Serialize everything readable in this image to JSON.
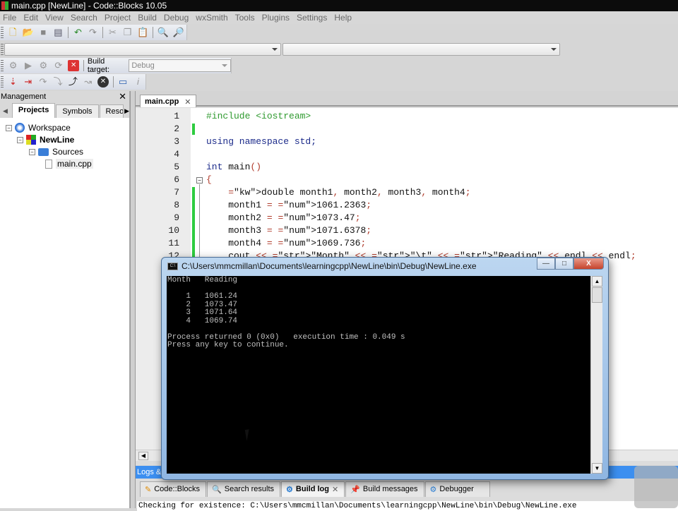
{
  "window": {
    "title": "main.cpp [NewLine] - Code::Blocks 10.05"
  },
  "menu": [
    "File",
    "Edit",
    "View",
    "Search",
    "Project",
    "Build",
    "Debug",
    "wxSmith",
    "Tools",
    "Plugins",
    "Settings",
    "Help"
  ],
  "toolbar": {
    "main_icons": [
      "new-file-icon",
      "open-icon",
      "save-icon",
      "save-all-icon",
      "undo-icon",
      "redo-icon",
      "cut-icon",
      "copy-icon",
      "paste-icon",
      "find-icon",
      "replace-icon"
    ],
    "build_icons": [
      "build-gear-icon",
      "run-icon",
      "build-run-icon",
      "rebuild-icon",
      "abort-icon"
    ],
    "build_target_label": "Build target:",
    "build_target_value": "Debug",
    "debug_icons": [
      "debug-run-icon",
      "run-to-cursor-icon",
      "next-line-icon",
      "step-into-icon",
      "step-out-icon",
      "next-instruction-icon",
      "stop-debug-icon",
      "debug-windows-icon",
      "info-icon"
    ]
  },
  "management": {
    "title": "Management",
    "tabs": [
      "Projects",
      "Symbols",
      "Resou"
    ],
    "active_tab": "Projects",
    "tree": [
      {
        "label": "Workspace",
        "icon": "workspace-icon",
        "level": 0
      },
      {
        "label": "NewLine",
        "icon": "project-icon",
        "level": 1,
        "bold": true
      },
      {
        "label": "Sources",
        "icon": "folder-icon",
        "level": 2
      },
      {
        "label": "main.cpp",
        "icon": "file-icon",
        "level": 3
      }
    ]
  },
  "editor": {
    "tab_label": "main.cpp",
    "lines": [
      {
        "n": "1",
        "text": "#include <iostream>"
      },
      {
        "n": "2",
        "text": ""
      },
      {
        "n": "3",
        "text": "using namespace std;"
      },
      {
        "n": "4",
        "text": ""
      },
      {
        "n": "5",
        "text": "int main()"
      },
      {
        "n": "6",
        "text": "{"
      },
      {
        "n": "7",
        "text": "    double month1, month2, month3, month4;"
      },
      {
        "n": "8",
        "text": "    month1 = 1061.2363;"
      },
      {
        "n": "9",
        "text": "    month2 = 1073.47;"
      },
      {
        "n": "10",
        "text": "    month3 = 1071.6378;"
      },
      {
        "n": "11",
        "text": "    month4 = 1069.736;"
      },
      {
        "n": "12",
        "text": "    cout << \"Month\" << \"\\t\" << \"Reading\" << endl << endl;"
      }
    ]
  },
  "console": {
    "title": "C:\\Users\\mmcmillan\\Documents\\learningcpp\\NewLine\\bin\\Debug\\NewLine.exe",
    "output": "Month   Reading\n\n    1   1061.24\n    2   1073.47\n    3   1071.64\n    4   1069.74\n\nProcess returned 0 (0x0)   execution time : 0.049 s\nPress any key to continue.",
    "buttons": {
      "minimize": "—",
      "maximize": "□",
      "close": "X"
    }
  },
  "logs": {
    "title": "Logs & others",
    "tabs": [
      {
        "label": "Code::Blocks",
        "icon": "pencil-icon"
      },
      {
        "label": "Search results",
        "icon": "search-icon"
      },
      {
        "label": "Build log",
        "icon": "gear-icon",
        "active": true,
        "closable": true
      },
      {
        "label": "Build messages",
        "icon": "pin-icon"
      },
      {
        "label": "Debugger",
        "icon": "gear-icon"
      }
    ],
    "text": "Checking for existence: C:\\Users\\mmcmillan\\Documents\\learningcpp\\NewLine\\bin\\Debug\\NewLine.exe"
  },
  "colors": {
    "accent": "#3c8ff0",
    "change_marker": "#2ecc40",
    "keyword": "#1b2a8a",
    "preprocessor": "#2f9a2f",
    "number": "#b04ab0"
  }
}
